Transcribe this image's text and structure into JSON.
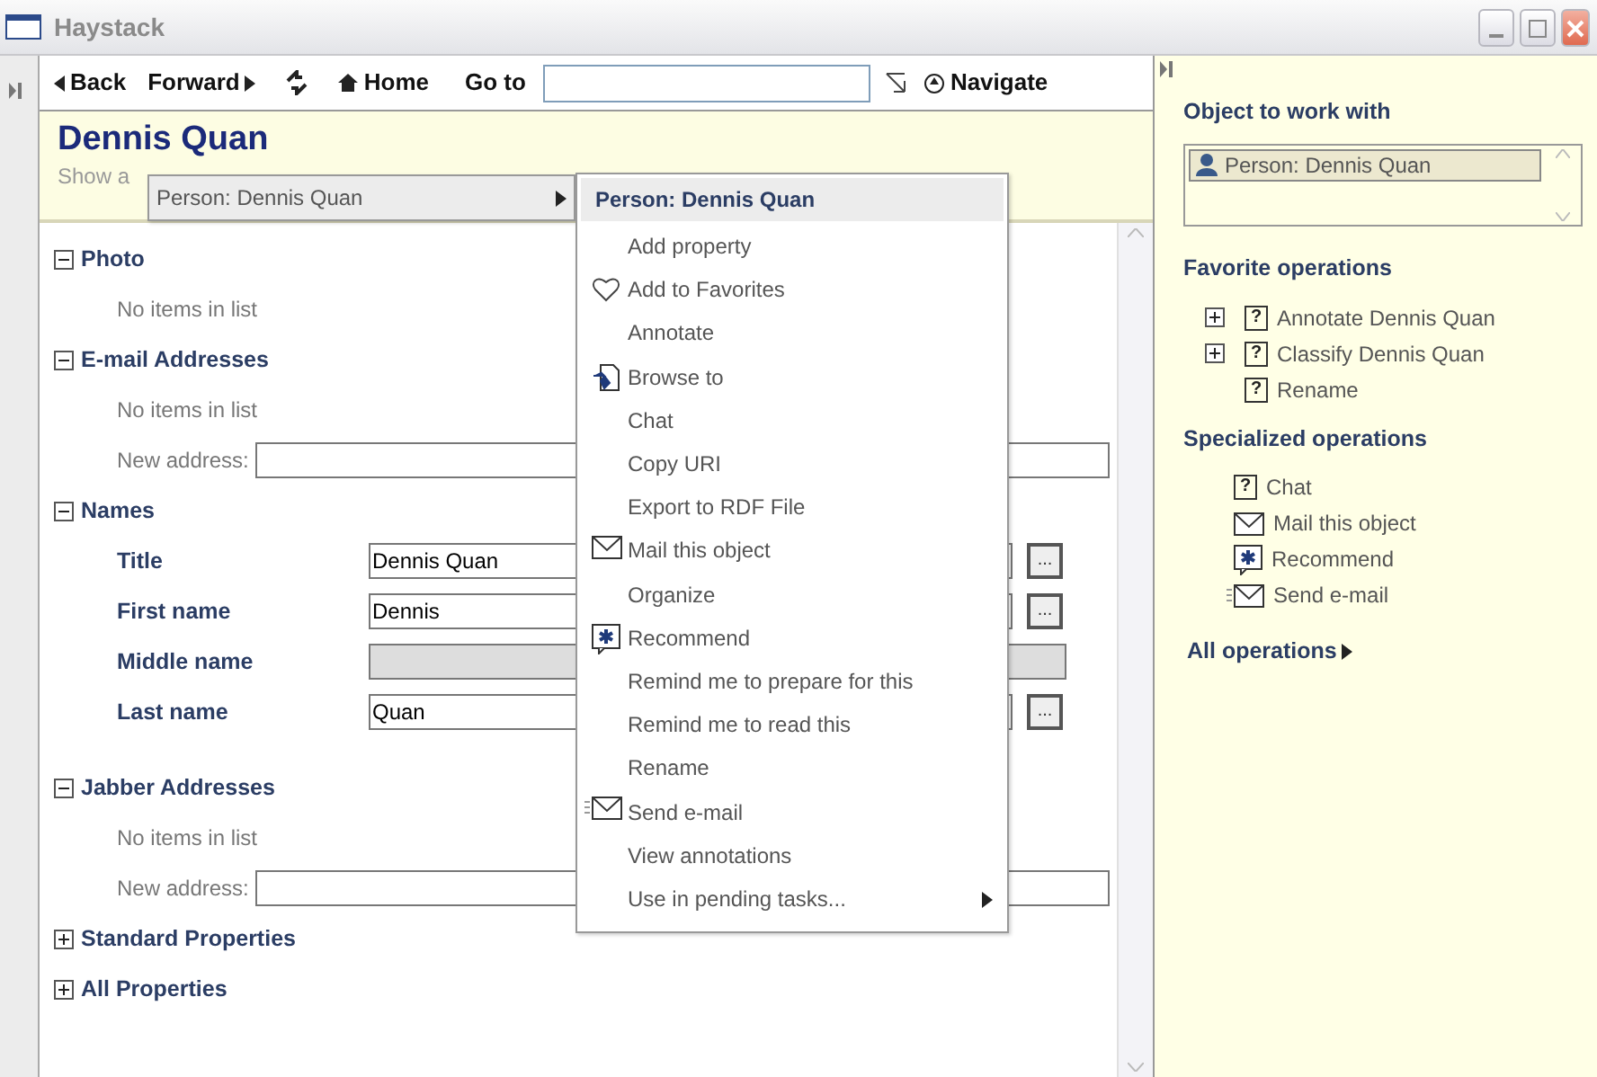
{
  "window": {
    "title": "Haystack"
  },
  "toolbar": {
    "back": "Back",
    "forward": "Forward",
    "home": "Home",
    "goto_label": "Go to",
    "navigate": "Navigate"
  },
  "header": {
    "title": "Dennis Quan",
    "subtitle": "Show a"
  },
  "sections": [
    {
      "title": "Photo",
      "expanded": true,
      "rows": [
        {
          "kind": "empty",
          "text": "No items in list"
        }
      ]
    },
    {
      "title": "E-mail Addresses",
      "expanded": true,
      "rows": [
        {
          "kind": "empty",
          "text": "No items in list"
        },
        {
          "kind": "new",
          "label": "New address:"
        }
      ]
    },
    {
      "title": "Names",
      "expanded": true,
      "rows": [
        {
          "kind": "field",
          "label": "Title",
          "value": "Dennis Quan",
          "disabled": false,
          "browse": "..."
        },
        {
          "kind": "field",
          "label": "First name",
          "value": "Dennis",
          "disabled": false,
          "browse": "..."
        },
        {
          "kind": "field",
          "label": "Middle name",
          "disabled": true
        },
        {
          "kind": "field",
          "label": "Last name",
          "value": "Quan",
          "disabled": false,
          "browse": "..."
        }
      ]
    },
    {
      "title": "Jabber Addresses",
      "expanded": true,
      "rows": [
        {
          "kind": "empty",
          "text": "No items in list"
        },
        {
          "kind": "new",
          "label": "New address:"
        }
      ]
    },
    {
      "title": "Standard Properties",
      "expanded": false
    },
    {
      "title": "All Properties",
      "expanded": false
    }
  ],
  "submenu": {
    "label": "Person: Dennis Quan",
    "submenu": true
  },
  "context_menu": {
    "title": "Person: Dennis Quan",
    "items": [
      {
        "label": "Add property",
        "kind": "plain"
      },
      {
        "label": "Add to Favorites",
        "kind": "favorite"
      },
      {
        "label": "Annotate",
        "kind": "plain"
      },
      {
        "label": "Browse to",
        "kind": "browse"
      },
      {
        "label": "Chat",
        "kind": "plain"
      },
      {
        "label": "Copy URI",
        "kind": "plain"
      },
      {
        "label": "Export to RDF File",
        "kind": "plain"
      },
      {
        "label": "Mail this object",
        "kind": "mail"
      },
      {
        "label": "Organize",
        "kind": "plain"
      },
      {
        "label": "Recommend",
        "kind": "recommend"
      },
      {
        "label": "Remind me to prepare for this",
        "kind": "plain"
      },
      {
        "label": "Remind me to read this",
        "kind": "plain"
      },
      {
        "label": "Rename",
        "kind": "plain"
      },
      {
        "label": "Send e-mail",
        "kind": "send"
      },
      {
        "label": "View annotations",
        "kind": "plain"
      },
      {
        "label": "Use in pending tasks...",
        "kind": "plain",
        "submenu": true
      }
    ]
  },
  "side_panel": {
    "object_heading": "Object to work with",
    "objects": [
      {
        "label": "Person: Dennis Quan",
        "selected": true
      }
    ],
    "favorite_heading": "Favorite operations",
    "favorites": [
      {
        "label": "Annotate Dennis Quan",
        "expandable": true,
        "kind": "question",
        "glyph": "?"
      },
      {
        "label": "Classify Dennis Quan",
        "expandable": true,
        "kind": "question",
        "glyph": "?"
      },
      {
        "label": "Rename",
        "expandable": false,
        "kind": "question",
        "glyph": "?"
      }
    ],
    "specialized_heading": "Specialized operations",
    "specialized": [
      {
        "label": "Chat",
        "kind": "question",
        "glyph": "?"
      },
      {
        "label": "Mail this object",
        "kind": "mail"
      },
      {
        "label": "Recommend",
        "kind": "recommend"
      },
      {
        "label": "Send e-mail",
        "kind": "send"
      }
    ],
    "all_operations": "All operations"
  }
}
